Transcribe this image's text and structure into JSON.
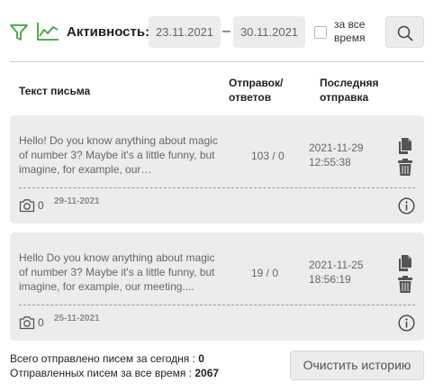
{
  "toolbar": {
    "activity_label": "Активность:",
    "date_from": "23.11.2021",
    "date_to": "30.11.2021",
    "dash": "–",
    "all_time_line1": "за все",
    "all_time_line2": "время",
    "filter_icon": "filter-icon",
    "chart_icon": "chart-icon",
    "search_icon": "search-icon",
    "accent_color": "#3aa53a"
  },
  "table": {
    "headers": {
      "text": "Текст письма",
      "sent_line1": "Отправок/",
      "sent_line2": "ответов",
      "last_line1": "Последняя",
      "last_line2": "отправка"
    },
    "rows": [
      {
        "text": "Hello! Do you know anything about magic of number 3? Maybe it's a little funny, but imagine, for example, our…",
        "count": "103 / 0",
        "date_line1": "2021-11-29",
        "date_line2": "12:55:38",
        "photos": "0",
        "created": "29-11-2021"
      },
      {
        "text": "Hello Do you know anything about magic of number 3? Maybe it's a little funny, but imagine, for example, our meeting....",
        "count": "19 / 0",
        "date_line1": "2021-11-25",
        "date_line2": "18:56:19",
        "photos": "0",
        "created": "25-11-2021"
      }
    ]
  },
  "footer": {
    "today_label": "Всего отправлено писем за сегодня : ",
    "today_value": "0",
    "total_label": "Отправленных писем за все время : ",
    "total_value": "2067",
    "clear_button": "Очистить историю"
  }
}
